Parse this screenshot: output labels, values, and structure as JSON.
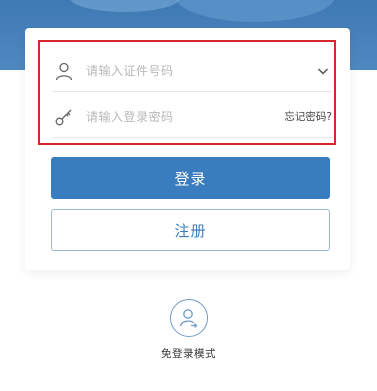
{
  "login": {
    "id_placeholder": "请输入证件号码",
    "password_placeholder": "请输入登录密码",
    "forgot_password": "忘记密码?",
    "login_button": "登录",
    "register_button": "注册"
  },
  "guest": {
    "label": "免登录模式"
  },
  "colors": {
    "primary": "#3a7dbf",
    "highlight": "#d7262d",
    "placeholder": "#b8b8b8"
  },
  "icons": {
    "user": "user-icon",
    "key": "key-icon",
    "chevron": "chevron-down-icon",
    "guest": "guest-mode-icon"
  }
}
